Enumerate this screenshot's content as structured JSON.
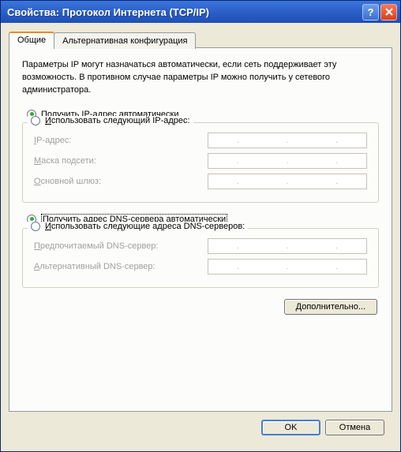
{
  "title": "Свойства: Протокол Интернета (TCP/IP)",
  "tabs": {
    "general": "Общие",
    "alternate": "Альтернативная конфигурация"
  },
  "description": "Параметры IP могут назначаться автоматически, если сеть поддерживает эту возможность. В противном случае параметры IP можно получить у сетевого администратора.",
  "ip": {
    "auto_label_prefix": "П",
    "auto_label_rest": "олучить IP-адрес автоматически",
    "manual_label_prefix": "И",
    "manual_label_rest": "спользовать следующий IP-адрес:",
    "addr_u": "I",
    "addr_rest": "P-адрес:",
    "mask_u": "М",
    "mask_rest": "аска подсети:",
    "gw_u": "О",
    "gw_rest": "сновной шлюз:"
  },
  "dns": {
    "auto_label_prefix": "П",
    "auto_label_rest": "олучить адрес DNS-сервера автоматически",
    "manual_label_prefix": "И",
    "manual_label_rest": "спользовать следующие адреса DNS-серверов:",
    "pref_u": "П",
    "pref_rest": "редпочитаемый DNS-сервер:",
    "alt_u": "А",
    "alt_rest": "льтернативный DNS-сервер:"
  },
  "advanced_btn_u": "Д",
  "advanced_btn_rest": "ополнительно...",
  "ok": "OK",
  "cancel": "Отмена"
}
